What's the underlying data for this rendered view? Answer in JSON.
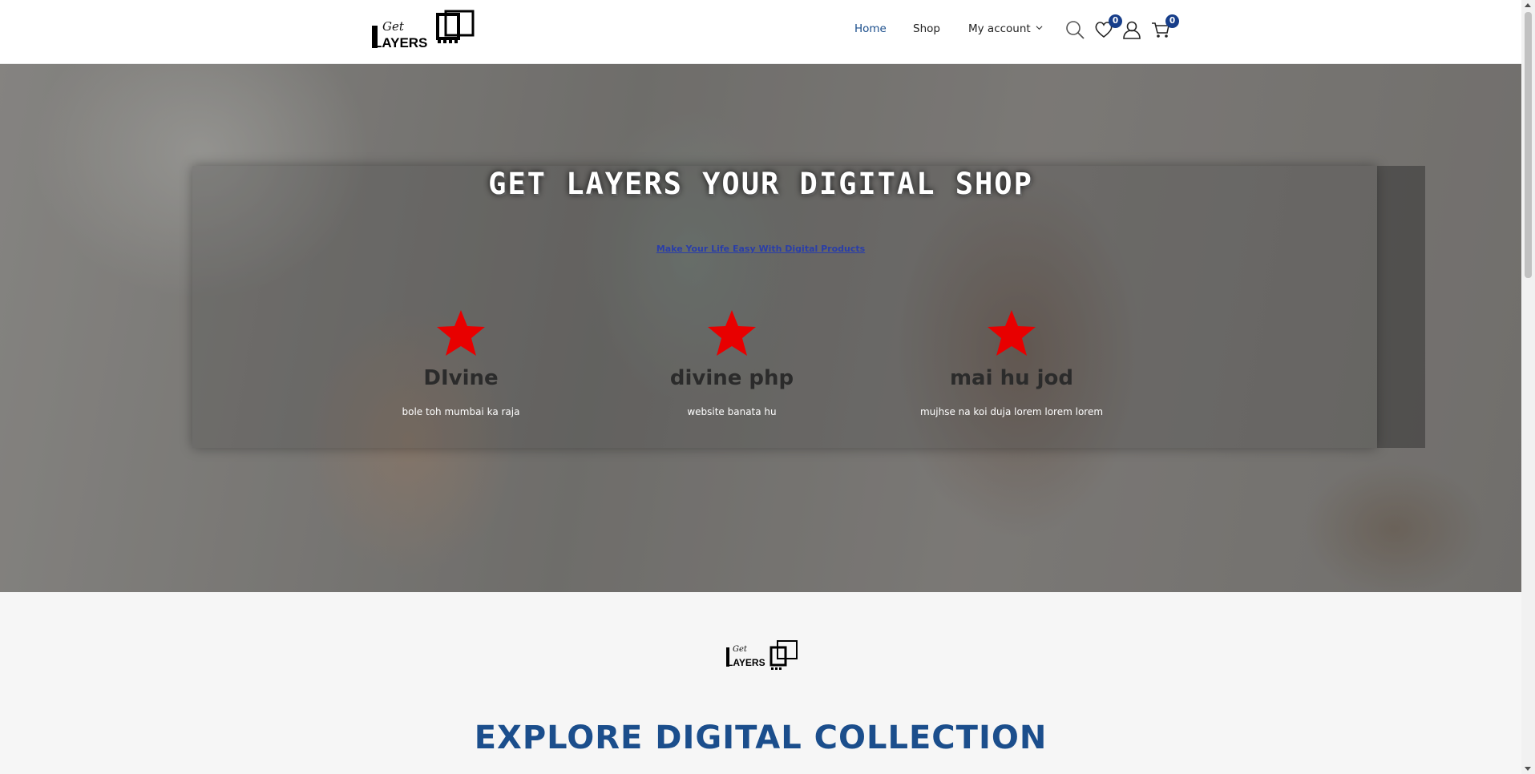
{
  "header": {
    "logo_text_top": "Get",
    "logo_text_main": "LAYERS",
    "nav": {
      "home": "Home",
      "shop": "Shop",
      "account": "My account"
    },
    "wishlist_count": "0",
    "cart_count": "0",
    "accent_color": "#1b4e8c",
    "badge_color": "#173e8a"
  },
  "hero": {
    "title": "GET LAYERS YOUR DIGITAL SHOP",
    "link": "Make Your Life Easy With Digital Products",
    "features": [
      {
        "icon": "star-icon",
        "title": "DIvine",
        "text": "bole toh mumbai ka raja"
      },
      {
        "icon": "star-icon",
        "title": "divine php",
        "text": "website banata hu"
      },
      {
        "icon": "star-icon",
        "title": "mai hu jod",
        "text": "mujhse na koi duja lorem lorem lorem"
      }
    ],
    "star_color": "#e80000"
  },
  "section": {
    "logo_text_top": "Get",
    "logo_text_main": "LAYERS",
    "title": "EXPLORE DIGITAL COLLECTION"
  }
}
